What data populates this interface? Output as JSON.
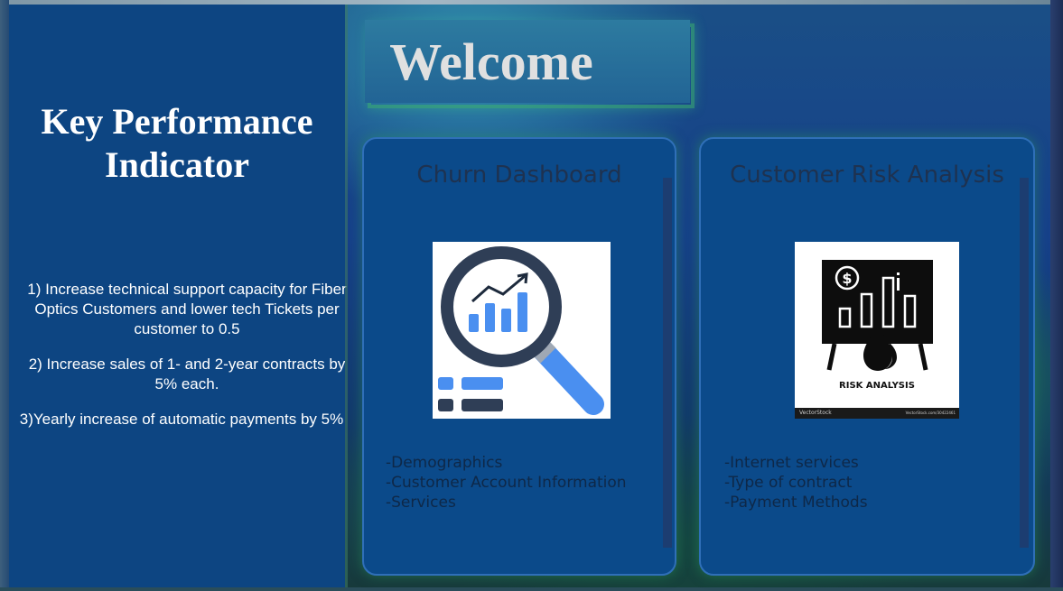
{
  "kpi": {
    "title_line1": "Key Performance",
    "title_line2": "Indicator",
    "items": [
      "1) Increase technical support capacity for Fiber Optics Customers and lower tech Tickets per customer to 0.5",
      "2) Increase sales of 1- and 2-year contracts by 5% each.",
      "3)Yearly increase of automatic payments by 5%"
    ]
  },
  "welcome": {
    "text": "Welcome"
  },
  "cards": [
    {
      "title": "Churn Dashboard",
      "image_icon": "magnifier-chart-icon",
      "items": [
        "-Demographics",
        "-Customer Account Information",
        "-Services"
      ]
    },
    {
      "title": "Customer Risk Analysis",
      "image_icon": "risk-analysis-board-icon",
      "image_caption": "RISK ANALYSIS",
      "watermark": "VectorStock",
      "watermark_id": "VectorStock.com/30422461",
      "items": [
        "-Internet services",
        "-Type of contract",
        "-Payment Methods"
      ]
    }
  ],
  "colors": {
    "kpi_panel": "#0d4582",
    "card_bg": "#0b4a8a",
    "card_title": "#1e3250",
    "welcome_box": "#2d7ba0",
    "accent_blue": "#3f8cf0",
    "dark_navy": "#2f3e56"
  }
}
